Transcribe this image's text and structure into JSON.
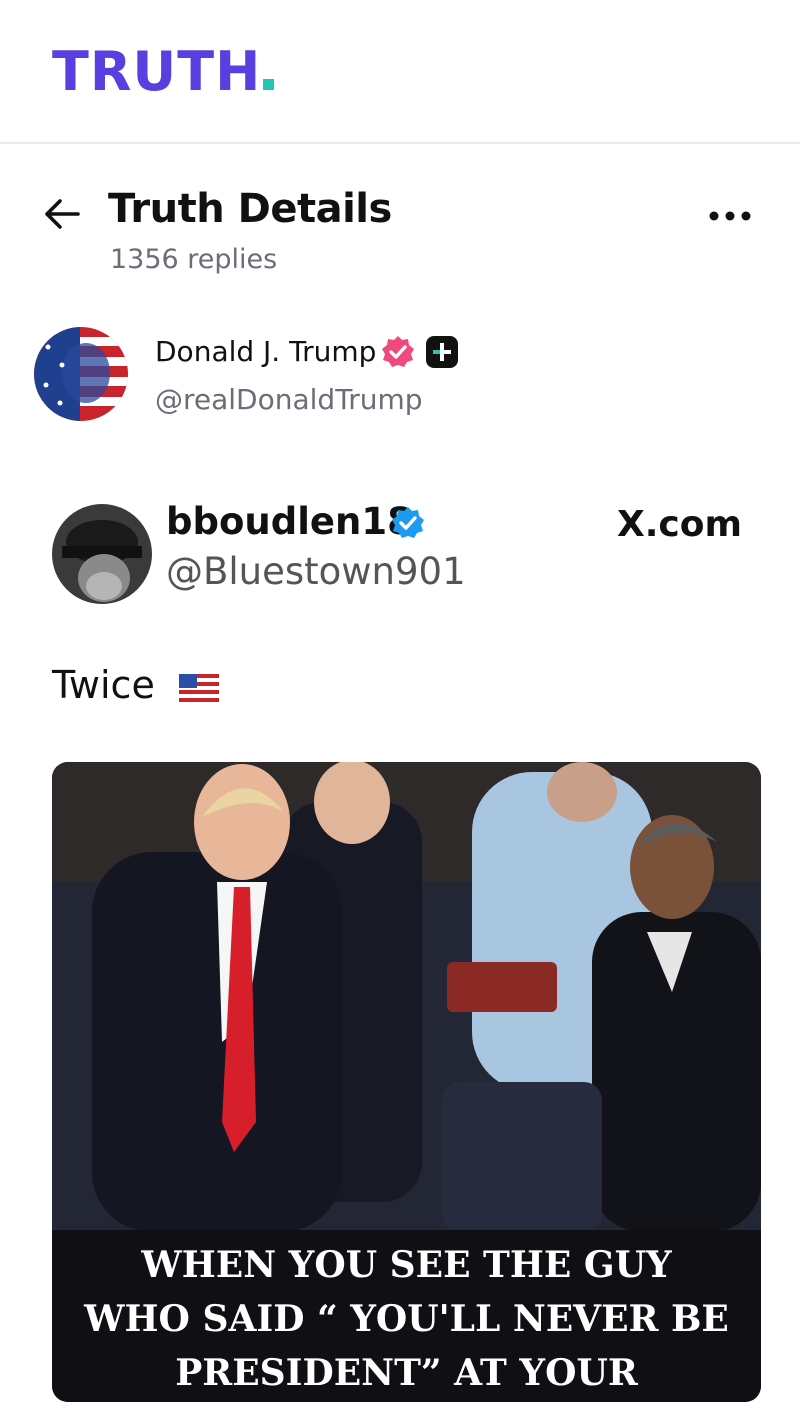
{
  "brand": {
    "name": "TRUTH",
    "color": "#5a3fe0",
    "accent": "#21c6b4"
  },
  "header": {
    "title": "Truth Details",
    "subtitle": "1356 replies"
  },
  "author": {
    "name": "Donald J. Trump",
    "handle": "@realDonaldTrump",
    "verified_color": "#ef4a7b"
  },
  "embed": {
    "name": "bboudlen18",
    "handle": "@Bluestown901",
    "source": "X.com",
    "verified_color": "#1d9bf0"
  },
  "post": {
    "text": "Twice"
  },
  "media": {
    "caption_line1": "WHEN YOU SEE THE GUY",
    "caption_line2": "WHO SAID “ YOU'LL NEVER BE",
    "caption_line3": "PRESIDENT” AT YOUR"
  },
  "icons": [
    "back-arrow-icon",
    "more-icon",
    "verified-badge-icon",
    "truth-plus-icon",
    "us-flag-icon"
  ]
}
